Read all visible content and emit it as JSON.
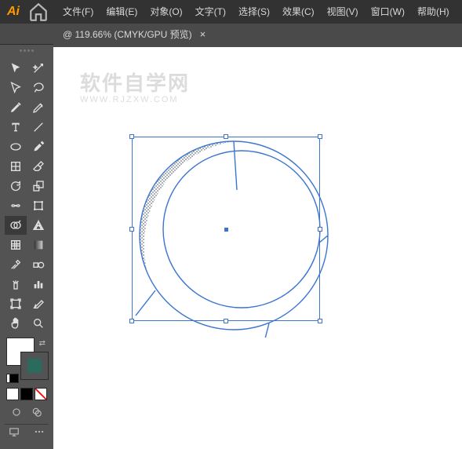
{
  "app": {
    "id": "Ai"
  },
  "menu": {
    "file": "文件(F)",
    "edit": "编辑(E)",
    "object": "对象(O)",
    "type": "文字(T)",
    "select": "选择(S)",
    "effect": "效果(C)",
    "view": "视图(V)",
    "window": "窗口(W)",
    "help": "帮助(H)"
  },
  "tab": {
    "label": "@ 119.66% (CMYK/GPU 预览)",
    "close": "×"
  },
  "watermark": {
    "line1": "软件自学网",
    "line2": "WWW.RJZXW.COM"
  },
  "canvas": {
    "zoom_percent": 119.66,
    "color_mode": "CMYK",
    "preview_mode": "GPU"
  },
  "colors": {
    "fill": "none",
    "stroke": "#2a6b5d",
    "selection": "#3b74d1"
  }
}
